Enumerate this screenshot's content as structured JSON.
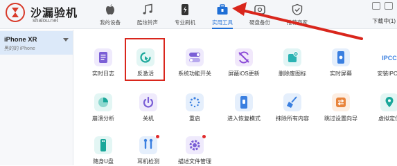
{
  "brand": {
    "title": "沙漏验机",
    "subtitle": "shalou.net"
  },
  "nav": {
    "items": [
      {
        "label": "我的设备",
        "icon": "apple-icon"
      },
      {
        "label": "酷炫铃声",
        "icon": "music-note-icon"
      },
      {
        "label": "专业刷机",
        "icon": "flash-phone-icon"
      },
      {
        "label": "实用工具",
        "icon": "toolbox-icon",
        "active": true
      },
      {
        "label": "硬盘备份",
        "icon": "backup-icon"
      },
      {
        "label": "推荐商家",
        "icon": "shield-check-icon"
      }
    ],
    "download_label": "下载中(1)"
  },
  "device": {
    "name": "iPhone XR",
    "status": "黑的的 iPhone"
  },
  "tools": [
    {
      "label": "实时日志",
      "icon": "log-icon",
      "color": "#7b5fd6"
    },
    {
      "label": "反激活",
      "icon": "reactivate-icon",
      "color": "#1aa79a"
    },
    {
      "label": "系统功能开关",
      "icon": "toggle-icon",
      "color": "#7b5fd6"
    },
    {
      "label": "屏蔽iOS更新",
      "icon": "block-update-icon",
      "color": "#8a4ad6"
    },
    {
      "label": "删除废图标",
      "icon": "delete-icon-icon",
      "color": "#2bb3b3"
    },
    {
      "label": "实时屏幕",
      "icon": "screen-icon",
      "color": "#3a7fe0"
    },
    {
      "label": "安装IPCC",
      "icon": "ipcc-icon",
      "color": "#3a7fe0"
    },
    {
      "label": "崩溃分析",
      "icon": "pie-chart-icon",
      "color": "#1aa79a"
    },
    {
      "label": "关机",
      "icon": "power-icon",
      "color": "#7b5fd6"
    },
    {
      "label": "重启",
      "icon": "restart-icon",
      "color": "#3a7fe0"
    },
    {
      "label": "进入恢复模式",
      "icon": "recovery-icon",
      "color": "#3a7fe0"
    },
    {
      "label": "抹除所有内容",
      "icon": "broom-icon",
      "color": "#3a7fe0"
    },
    {
      "label": "跳过设置向导",
      "icon": "skip-icon",
      "color": "#e8833a"
    },
    {
      "label": "虚拟定位",
      "icon": "location-icon",
      "color": "#1aa79a"
    },
    {
      "label": "随身U盘",
      "icon": "usb-icon",
      "color": "#1aa79a"
    },
    {
      "label": "耳机检测",
      "icon": "headphone-icon",
      "color": "#3a7fe0"
    },
    {
      "label": "描述文件管理",
      "icon": "gear-icon",
      "color": "#7b5fd6"
    }
  ],
  "accent_color": "#1f6fd6",
  "highlight_color": "#d9261c"
}
